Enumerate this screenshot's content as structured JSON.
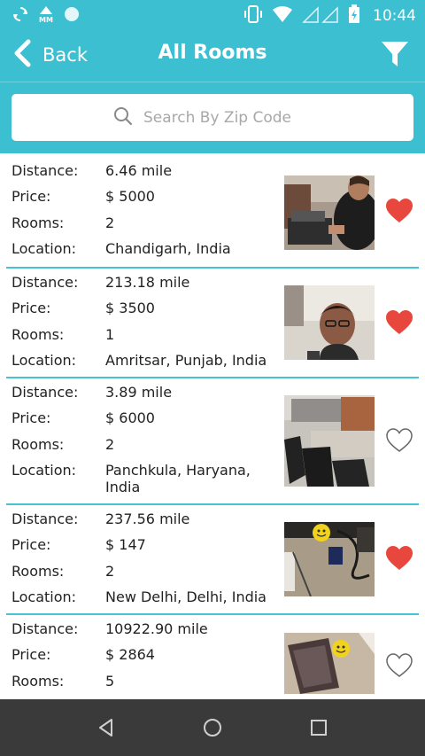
{
  "status_bar": {
    "time": "10:44"
  },
  "header": {
    "back_label": "Back",
    "title": "All Rooms"
  },
  "search": {
    "placeholder": "Search By Zip Code"
  },
  "labels": {
    "distance": "Distance:",
    "price": "Price:",
    "rooms": "Rooms:",
    "location": "Location:"
  },
  "rooms": [
    {
      "distance": "6.46 mile",
      "price": "$ 5000",
      "rooms": "2",
      "location": "Chandigarh, India",
      "favorite": true
    },
    {
      "distance": "213.18 mile",
      "price": "$ 3500",
      "rooms": "1",
      "location": "Amritsar, Punjab, India",
      "favorite": true
    },
    {
      "distance": "3.89 mile",
      "price": "$ 6000",
      "rooms": "2",
      "location": "Panchkula, Haryana, India",
      "favorite": false
    },
    {
      "distance": "237.56 mile",
      "price": "$ 147",
      "rooms": "2",
      "location": "New Delhi, Delhi, India",
      "favorite": true
    },
    {
      "distance": "10922.90 mile",
      "price": "$ 2864",
      "rooms": "5",
      "location": "",
      "favorite": false
    }
  ],
  "colors": {
    "accent": "#3cbfd1",
    "heart_filled": "#e8473d",
    "nav_bar": "#3a3a3a"
  },
  "icons": {
    "header": [
      "back-icon",
      "filter-icon",
      "search-icon"
    ],
    "status": [
      "sync-icon",
      "mm-icon",
      "circle-icon",
      "vibrate-icon",
      "wifi-icon",
      "signal-icon",
      "battery-icon"
    ],
    "nav": [
      "nav-back-icon",
      "nav-home-icon",
      "nav-recents-icon"
    ]
  }
}
